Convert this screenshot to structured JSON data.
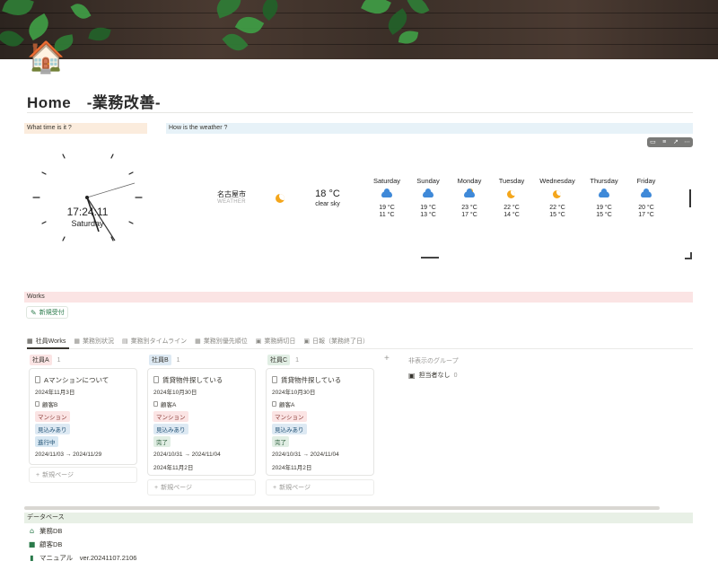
{
  "page": {
    "icon": "🏠",
    "icon_name": "house-icon",
    "title": "Home　-業務改善-"
  },
  "callouts": {
    "time": "What time is it ?",
    "weather": "How is the weather ?",
    "works": "Works"
  },
  "clock": {
    "time": "17:24:11",
    "day": "Saturday"
  },
  "weather": {
    "city": "名古屋市",
    "label": "WEATHER",
    "current_temp": "18 °C",
    "current_desc": "clear sky",
    "current_icon": "moon-icon",
    "forecast": [
      {
        "day": "Saturday",
        "icon": "cloud-rain-icon",
        "hi": "19 °C",
        "lo": "11 °C"
      },
      {
        "day": "Sunday",
        "icon": "cloud-rain-icon",
        "hi": "19 °C",
        "lo": "13 °C"
      },
      {
        "day": "Monday",
        "icon": "sun-cloud-icon",
        "hi": "23 °C",
        "lo": "17 °C"
      },
      {
        "day": "Tuesday",
        "icon": "moon-icon",
        "hi": "22 °C",
        "lo": "14 °C"
      },
      {
        "day": "Wednesday",
        "icon": "moon-icon",
        "hi": "22 °C",
        "lo": "15 °C"
      },
      {
        "day": "Thursday",
        "icon": "cloud-rain-icon",
        "hi": "19 °C",
        "lo": "15 °C"
      },
      {
        "day": "Friday",
        "icon": "cloud-rain-icon",
        "hi": "20 °C",
        "lo": "17 °C"
      }
    ]
  },
  "works": {
    "new_button": "新規受付"
  },
  "tabs": [
    {
      "label": "社員Works",
      "icon": "table-icon",
      "active": true
    },
    {
      "label": "業務別状況",
      "icon": "table-icon",
      "active": false
    },
    {
      "label": "業務別タイムライン",
      "icon": "timeline-icon",
      "active": false
    },
    {
      "label": "業務別優先順位",
      "icon": "table-icon",
      "active": false
    },
    {
      "label": "業務締切日",
      "icon": "calendar-icon",
      "active": false
    },
    {
      "label": "日報（業務終了日）",
      "icon": "calendar-icon",
      "active": false
    }
  ],
  "board": {
    "columns": [
      {
        "label": "社員A",
        "count": "1",
        "card": {
          "title": "Aマンションについて",
          "date": "2024年11月3日",
          "client": "顧客B",
          "tags": [
            "マンション",
            "見込みあり",
            "進行中"
          ],
          "period": "2024/11/03 → 2024/11/29",
          "end_date": ""
        }
      },
      {
        "label": "社員B",
        "count": "1",
        "card": {
          "title": "賃貸物件探している",
          "date": "2024年10月30日",
          "client": "顧客A",
          "tags": [
            "マンション",
            "見込みあり",
            "完了"
          ],
          "period": "2024/10/31 → 2024/11/04",
          "end_date": "2024年11月2日"
        }
      },
      {
        "label": "社員C",
        "count": "1",
        "card": {
          "title": "賃貸物件探している",
          "date": "2024年10月30日",
          "client": "顧客A",
          "tags": [
            "マンション",
            "見込みあり",
            "完了"
          ],
          "period": "2024/10/31 → 2024/11/04",
          "end_date": "2024年11月2日"
        }
      }
    ],
    "new_page": "新規ページ",
    "hidden_groups": "非表示のグループ",
    "no_assignee": "担当者なし",
    "no_assignee_count": "0"
  },
  "database": {
    "header": "データベース",
    "items": [
      {
        "label": "業務DB",
        "icon": "home-icon"
      },
      {
        "label": "顧客DB",
        "icon": "person-icon"
      },
      {
        "label": "マニュアル　ver.20241107.2106",
        "icon": "book-icon"
      }
    ]
  },
  "colors": {
    "accent_green": "#2a7a4a",
    "callout_orange": "#fbecdd",
    "callout_blue": "#e7f2f8",
    "callout_red": "#fbe4e4",
    "db_green": "#e8f0e6"
  }
}
